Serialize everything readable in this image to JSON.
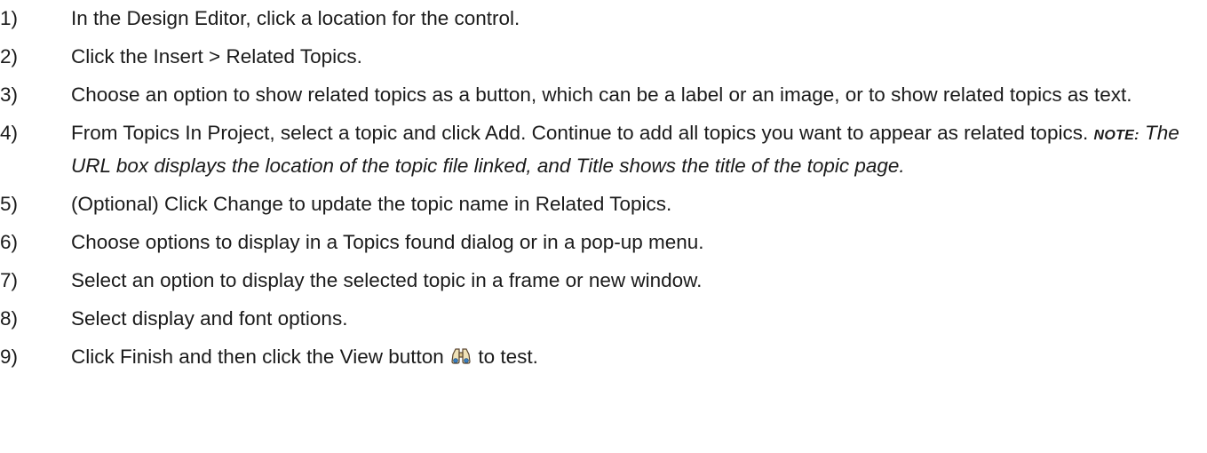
{
  "steps": [
    {
      "num": "1)",
      "text": "In the Design Editor, click a location for the control."
    },
    {
      "num": "2)",
      "text": "Click the Insert > Related Topics."
    },
    {
      "num": "3)",
      "text": "Choose an option to show related topics as a button, which can be a label or an image, or to show related topics as text."
    },
    {
      "num": "4)",
      "text": "From Topics In Project, select a topic and click Add. Continue to add all topics you want to appear as related topics.",
      "note_label": "NOTE:",
      "note_text": "The URL box displays the location of the topic file linked, and Title shows the title of the topic page."
    },
    {
      "num": "5)",
      "text": "(Optional) Click Change to update the topic name in Related Topics."
    },
    {
      "num": "6)",
      "text": "Choose options to display in a Topics found dialog or in a pop-up menu."
    },
    {
      "num": "7)",
      "text": "Select an option to display the selected topic in a frame or new window."
    },
    {
      "num": "8)",
      "text": "Select display and font options."
    },
    {
      "num": "9)",
      "text_before": "Click Finish and then click the View button",
      "icon": "binoculars-icon",
      "text_after": "to test."
    }
  ]
}
